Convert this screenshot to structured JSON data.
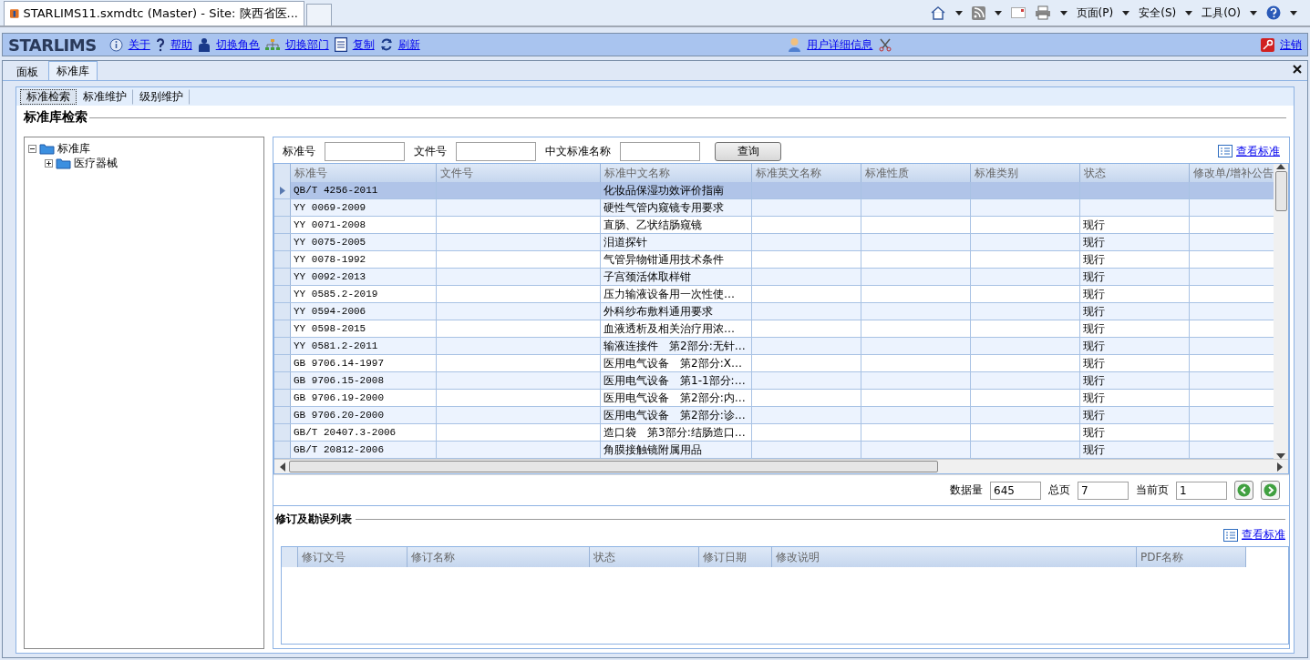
{
  "browser": {
    "tab_title": "STARLIMS11.sxmdtc (Master) - Site: 陕西省医...",
    "commands": [
      "页面(P)",
      "安全(S)",
      "工具(O)"
    ]
  },
  "app": {
    "logo": "STARLIMS",
    "links": [
      "关于",
      "帮助",
      "切换角色",
      "切换部门",
      "复制",
      "刷新"
    ],
    "user_link": "用户详细信息",
    "logout": "注销"
  },
  "tabs": [
    {
      "label": "面板",
      "selected": false
    },
    {
      "label": "标准库",
      "selected": true
    }
  ],
  "subtabs": [
    {
      "label": "标准检索",
      "selected": true
    },
    {
      "label": "标准维护",
      "selected": false
    },
    {
      "label": "级别维护",
      "selected": false
    }
  ],
  "section_title": "标准库检索",
  "tree": [
    {
      "label": "标准库",
      "expanded": true,
      "children": [
        {
          "label": "医疗器械",
          "expanded": false
        }
      ]
    }
  ],
  "search": {
    "fields": [
      {
        "label": "标准号"
      },
      {
        "label": "文件号"
      },
      {
        "label": "中文标准名称"
      }
    ],
    "button": "查询",
    "view_link": "查看标准"
  },
  "table": {
    "columns": [
      "标准号",
      "文件号",
      "标准中文名称",
      "标准英文名称",
      "标准性质",
      "标准类别",
      "状态",
      "修改单/增补公告"
    ],
    "rows": [
      {
        "no": "QB/T 4256-2011",
        "name": "化妆品保湿功效评价指南",
        "status": "",
        "selected": true
      },
      {
        "no": "YY 0069-2009",
        "name": "硬性气管内窥镜专用要求",
        "status": "",
        "selected": false
      },
      {
        "no": "YY 0071-2008",
        "name": "直肠、乙状结肠窥镜",
        "status": "现行",
        "selected": false
      },
      {
        "no": "YY 0075-2005",
        "name": "泪道探针",
        "status": "现行",
        "selected": false
      },
      {
        "no": "YY 0078-1992",
        "name": "气管异物钳通用技术条件",
        "status": "现行",
        "selected": false
      },
      {
        "no": "YY 0092-2013",
        "name": "子宫颈活体取样钳",
        "status": "现行",
        "selected": false
      },
      {
        "no": "YY 0585.2-2019",
        "name": "压力输液设备用一次性使…",
        "status": "现行",
        "selected": false
      },
      {
        "no": "YY 0594-2006",
        "name": "外科纱布敷料通用要求",
        "status": "现行",
        "selected": false
      },
      {
        "no": "YY 0598-2015",
        "name": "血液透析及相关治疗用浓…",
        "status": "现行",
        "selected": false
      },
      {
        "no": "YY 0581.2-2011",
        "name": "输液连接件　第2部分:无针…",
        "status": "现行",
        "selected": false
      },
      {
        "no": "GB 9706.14-1997",
        "name": "医用电气设备　第2部分:X…",
        "status": "现行",
        "selected": false
      },
      {
        "no": "GB 9706.15-2008",
        "name": "医用电气设备　第1-1部分:…",
        "status": "现行",
        "selected": false
      },
      {
        "no": "GB 9706.19-2000",
        "name": "医用电气设备　第2部分:内…",
        "status": "现行",
        "selected": false
      },
      {
        "no": "GB 9706.20-2000",
        "name": "医用电气设备　第2部分:诊…",
        "status": "现行",
        "selected": false
      },
      {
        "no": "GB/T 20407.3-2006",
        "name": "造口袋　第3部分:结肠造口…",
        "status": "现行",
        "selected": false
      },
      {
        "no": "GB/T 20812-2006",
        "name": "角膜接触镜附属用品",
        "status": "现行",
        "selected": false
      }
    ]
  },
  "pager": {
    "count_label": "数据量",
    "count": "645",
    "total_label": "总页",
    "total": "7",
    "current_label": "当前页",
    "current": "1"
  },
  "revisions": {
    "title": "修订及勘误列表",
    "view_link": "查看标准",
    "columns": [
      "修订文号",
      "修订名称",
      "状态",
      "修订日期",
      "修改说明",
      "PDF名称"
    ]
  }
}
